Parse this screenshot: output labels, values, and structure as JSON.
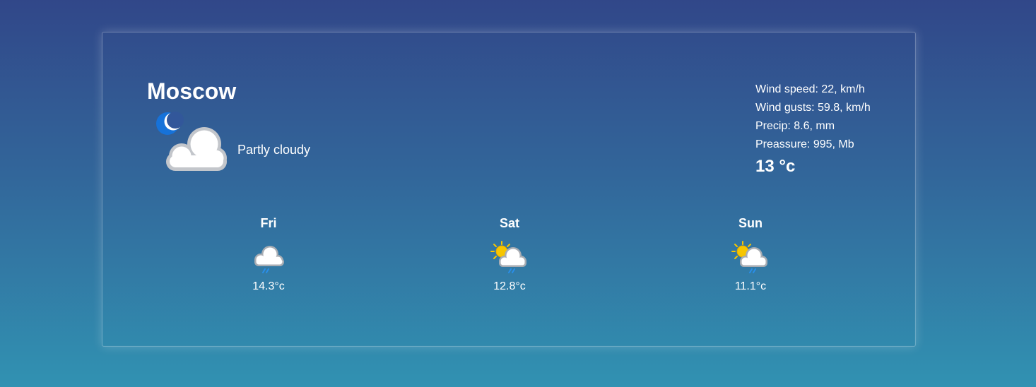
{
  "location": {
    "city": "Moscow"
  },
  "current": {
    "icon": "partly-cloudy-night-icon",
    "condition": "Partly cloudy",
    "wind_speed": "Wind speed: 22, km/h",
    "wind_gusts": "Wind gusts: 59.8, km/h",
    "precip": "Precip: 8.6, mm",
    "pressure": "Preassure: 995, Mb",
    "temperature": "13 °c"
  },
  "forecast": [
    {
      "day": "Fri",
      "icon": "cloud-rain-icon",
      "temp": "14.3°c"
    },
    {
      "day": "Sat",
      "icon": "sun-cloud-rain-icon",
      "temp": "12.8°c"
    },
    {
      "day": "Sun",
      "icon": "sun-cloud-rain-icon",
      "temp": "11.1°c"
    }
  ],
  "colors": {
    "background_top": "#314789",
    "background_bottom": "#3192b2",
    "text": "#ffffff",
    "moon": "#1672d9",
    "sun": "#f7c600",
    "cloud": "#ffffff",
    "cloud_outline": "#c3c6cb",
    "rain": "#2a8ee8"
  }
}
